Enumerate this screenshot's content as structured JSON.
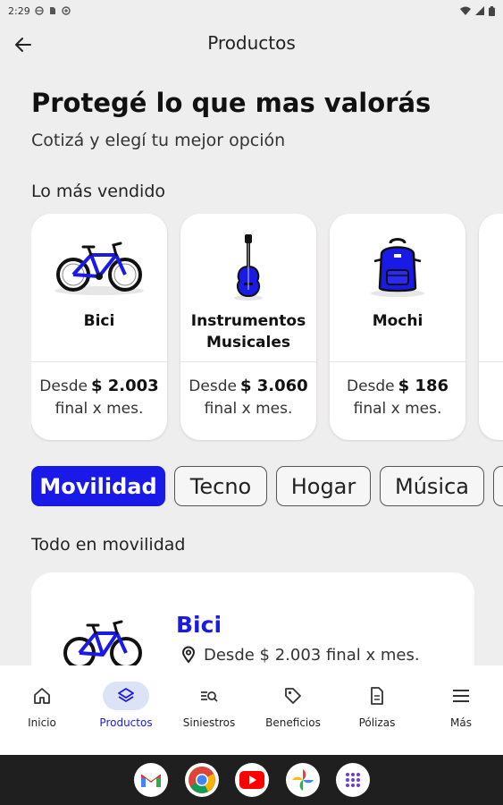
{
  "status_bar": {
    "time": "2:29"
  },
  "app_bar": {
    "title": "Productos"
  },
  "hero": {
    "title": "Protegé lo que mas valorás",
    "subtitle": "Cotizá y elegí tu mejor opción"
  },
  "best_sellers": {
    "title": "Lo más vendido",
    "cards": [
      {
        "name": "Bici",
        "from_label": "Desde",
        "price": "$ 2.003",
        "period": "final x mes.",
        "icon": "bicycle-icon"
      },
      {
        "name": "Instrumentos Musicales",
        "from_label": "Desde",
        "price": "$ 3.060",
        "period": "final x mes.",
        "icon": "guitar-icon"
      },
      {
        "name": "Mochi",
        "from_label": "Desde",
        "price": "$ 186",
        "period": "final x mes.",
        "icon": "backpack-icon"
      }
    ]
  },
  "categories": {
    "chips": [
      {
        "label": "Movilidad",
        "active": true
      },
      {
        "label": "Tecno",
        "active": false
      },
      {
        "label": "Hogar",
        "active": false
      },
      {
        "label": "Música",
        "active": false
      }
    ]
  },
  "mobility_section": {
    "title": "Todo en movilidad",
    "items": [
      {
        "name": "Bici",
        "price_text": "Desde $ 2.003 final x mes.",
        "icon": "bicycle-icon"
      }
    ]
  },
  "bottom_nav": {
    "items": [
      {
        "label": "Inicio",
        "icon": "home-icon",
        "active": false
      },
      {
        "label": "Productos",
        "icon": "layers-icon",
        "active": true
      },
      {
        "label": "Siniestros",
        "icon": "search-list-icon",
        "active": false
      },
      {
        "label": "Beneficios",
        "icon": "tag-icon",
        "active": false
      },
      {
        "label": "Pólizas",
        "icon": "document-icon",
        "active": false
      },
      {
        "label": "Más",
        "icon": "menu-icon",
        "active": false
      }
    ]
  },
  "dock": {
    "apps": [
      "gmail-icon",
      "chrome-icon",
      "youtube-icon",
      "photos-icon",
      "app-drawer-icon"
    ]
  },
  "colors": {
    "accent": "#1a1ae8",
    "background": "#efeeee",
    "card": "#ffffff",
    "nav_active_pill": "#dde3f7",
    "dock": "#1f1f1f"
  }
}
